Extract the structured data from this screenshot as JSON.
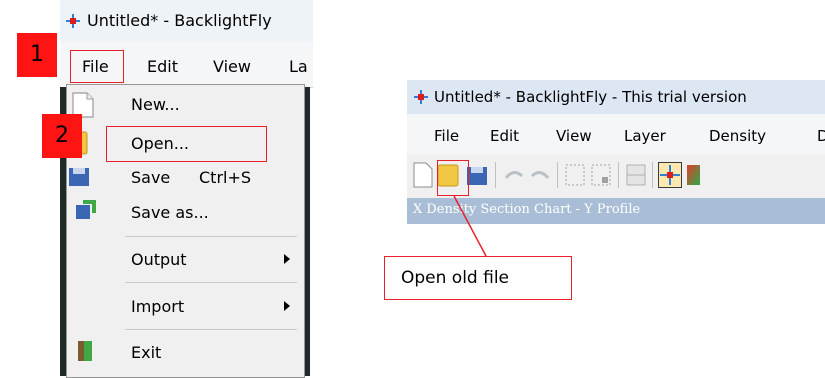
{
  "left": {
    "window_title": "Untitled* - BacklightFly",
    "menubar": [
      "File",
      "Edit",
      "View",
      "La"
    ],
    "file_menu": {
      "new": "New...",
      "open": "Open...",
      "save": "Save",
      "save_shortcut": "Ctrl+S",
      "save_as": "Save as...",
      "output": "Output",
      "import": "Import",
      "exit": "Exit"
    },
    "badge_1": "1",
    "badge_2": "2"
  },
  "right": {
    "window_title": "Untitled* - BacklightFly - This trial version",
    "menubar": [
      "File",
      "Edit",
      "View",
      "Layer",
      "Density",
      "D"
    ],
    "status_text": "X Density Section Chart - Y Profile",
    "callout_text": "Open old file"
  },
  "colors": {
    "annotation_red": "#e8202a",
    "badge_red": "#ff1414",
    "status_blue": "#a9bed6"
  }
}
